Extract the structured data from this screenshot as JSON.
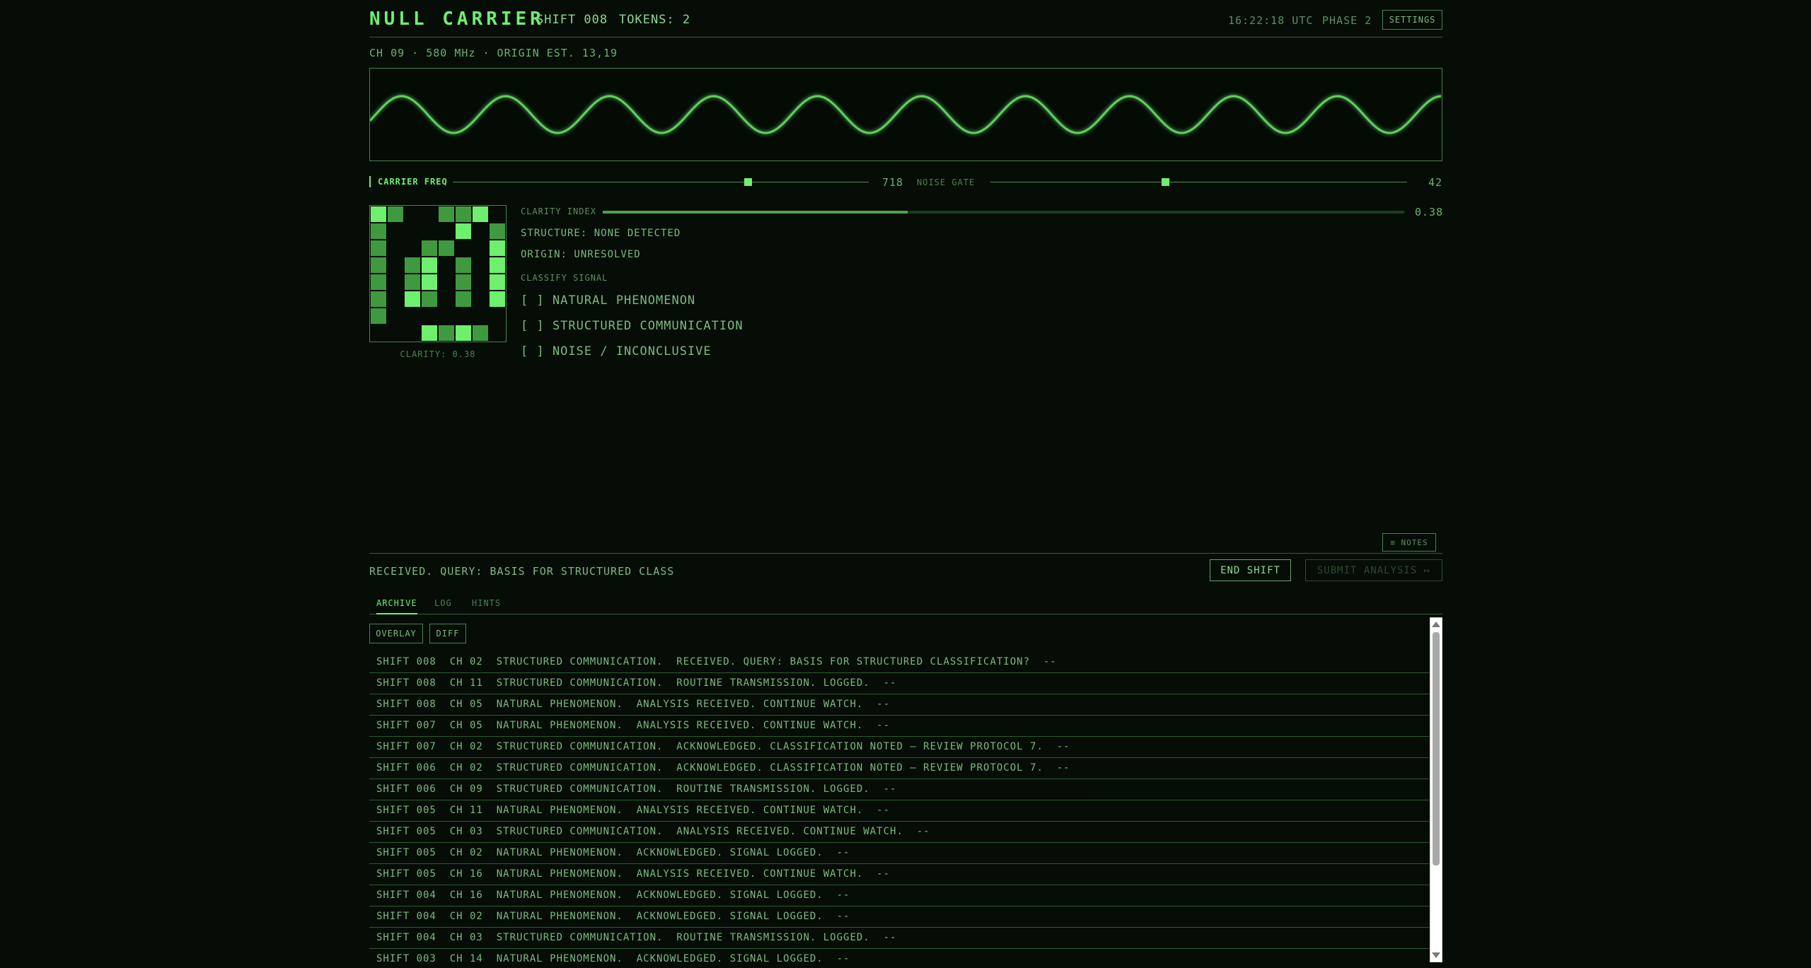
{
  "header": {
    "title": "NULL CARRIER",
    "shift": "SHIFT 008",
    "tokens": "TOKENS: 2",
    "clock": "16:22:18 UTC",
    "phase": "PHASE 2",
    "settings_label": "SETTINGS"
  },
  "channel_info": "CH 09  ·  580 MHz  ·  ORIGIN EST. 13,19",
  "controls": {
    "carrier_label": "CARRIER FREQ",
    "carrier_value": "718",
    "carrier_fraction": 0.71,
    "noise_label": "NOISE GATE",
    "noise_value": "42",
    "noise_fraction": 0.42
  },
  "glyph": {
    "rows": [
      [
        1,
        2,
        0,
        0,
        2,
        2,
        1,
        0
      ],
      [
        2,
        0,
        0,
        0,
        0,
        1,
        0,
        2
      ],
      [
        2,
        0,
        0,
        2,
        2,
        0,
        0,
        1
      ],
      [
        2,
        0,
        2,
        1,
        0,
        2,
        0,
        1
      ],
      [
        2,
        0,
        2,
        1,
        0,
        2,
        0,
        1
      ],
      [
        2,
        0,
        1,
        2,
        0,
        2,
        0,
        1
      ],
      [
        2,
        0,
        0,
        0,
        0,
        0,
        0,
        0
      ],
      [
        0,
        0,
        0,
        1,
        2,
        1,
        2,
        0
      ]
    ],
    "caption": "CLARITY: 0.38"
  },
  "analysis": {
    "clarity_label": "CLARITY INDEX",
    "clarity_value": "0.38",
    "clarity_fraction": 0.38,
    "structure": "STRUCTURE: NONE DETECTED",
    "origin": "ORIGIN: UNRESOLVED",
    "classify_heading": "CLASSIFY SIGNAL",
    "options": [
      "[ ] NATURAL PHENOMENON",
      "[ ] STRUCTURED COMMUNICATION",
      "[ ] NOISE / INCONCLUSIVE"
    ]
  },
  "notes_label": "≡ NOTES",
  "status_text": "RECEIVED. QUERY: BASIS FOR STRUCTURED CLASS",
  "end_shift_label": "END SHIFT",
  "submit_label": "SUBMIT ANALYSIS ↦",
  "tabs": [
    "ARCHIVE",
    "LOG",
    "HINTS"
  ],
  "archive_tools": [
    "OVERLAY",
    "DIFF"
  ],
  "archive": [
    "SHIFT 008  CH 02  STRUCTURED COMMUNICATION.  RECEIVED. QUERY: BASIS FOR STRUCTURED CLASSIFICATION?  --",
    "SHIFT 008  CH 11  STRUCTURED COMMUNICATION.  ROUTINE TRANSMISSION. LOGGED.  --",
    "SHIFT 008  CH 05  NATURAL PHENOMENON.  ANALYSIS RECEIVED. CONTINUE WATCH.  --",
    "SHIFT 007  CH 05  NATURAL PHENOMENON.  ANALYSIS RECEIVED. CONTINUE WATCH.  --",
    "SHIFT 007  CH 02  STRUCTURED COMMUNICATION.  ACKNOWLEDGED. CLASSIFICATION NOTED — REVIEW PROTOCOL 7.  --",
    "SHIFT 006  CH 02  STRUCTURED COMMUNICATION.  ACKNOWLEDGED. CLASSIFICATION NOTED — REVIEW PROTOCOL 7.  --",
    "SHIFT 006  CH 09  STRUCTURED COMMUNICATION.  ROUTINE TRANSMISSION. LOGGED.  --",
    "SHIFT 005  CH 11  NATURAL PHENOMENON.  ANALYSIS RECEIVED. CONTINUE WATCH.  --",
    "SHIFT 005  CH 03  STRUCTURED COMMUNICATION.  ANALYSIS RECEIVED. CONTINUE WATCH.  --",
    "SHIFT 005  CH 02  NATURAL PHENOMENON.  ACKNOWLEDGED. SIGNAL LOGGED.  --",
    "SHIFT 005  CH 16  NATURAL PHENOMENON.  ANALYSIS RECEIVED. CONTINUE WATCH.  --",
    "SHIFT 004  CH 16  NATURAL PHENOMENON.  ACKNOWLEDGED. SIGNAL LOGGED.  --",
    "SHIFT 004  CH 02  NATURAL PHENOMENON.  ACKNOWLEDGED. SIGNAL LOGGED.  --",
    "SHIFT 004  CH 03  STRUCTURED COMMUNICATION.  ROUTINE TRANSMISSION. LOGGED.  --",
    "SHIFT 003  CH 14  NATURAL PHENOMENON.  ACKNOWLEDGED. SIGNAL LOGGED.  --"
  ],
  "colors": {
    "background": "#050d06",
    "accent": "#6ef06e",
    "cell_bright": "#6ef06e",
    "cell_mid": "#3f9a3f",
    "wave": "#5fcf5f"
  }
}
